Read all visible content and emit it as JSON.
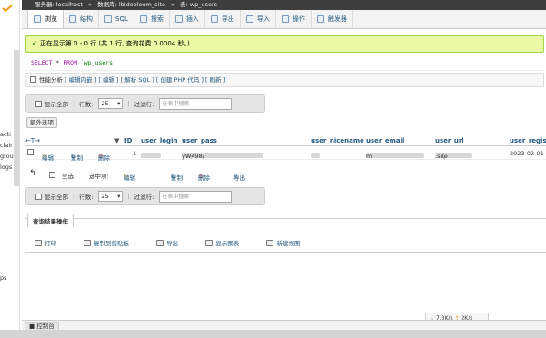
{
  "breadcrumb": {
    "server": "服务器: localhost",
    "database": "数据库: lbidobloom_site",
    "table": "表: wp_users"
  },
  "tabs": [
    {
      "label": "浏览",
      "icon": "browse-icon"
    },
    {
      "label": "结构",
      "icon": "structure-icon"
    },
    {
      "label": "SQL",
      "icon": "sql-icon"
    },
    {
      "label": "搜索",
      "icon": "search-icon"
    },
    {
      "label": "插入",
      "icon": "insert-icon"
    },
    {
      "label": "导出",
      "icon": "export-icon"
    },
    {
      "label": "导入",
      "icon": "import-icon"
    },
    {
      "label": "操作",
      "icon": "wrench-icon"
    },
    {
      "label": "触发器",
      "icon": "triggers-icon"
    }
  ],
  "message": "正在显示第 0 - 0 行 (共 1 行, 查询花费 0.0004 秒。)",
  "sql": {
    "keyword_select": "SELECT",
    "star": "*",
    "keyword_from": "FROM",
    "table": "`wp_users`"
  },
  "profiling": {
    "label": "性能分析",
    "links": "[ 编辑内嵌 ] [ 编辑 ] [ 解析 SQL ] [ 创建 PHP 代码 ] [ 刷新 ]"
  },
  "nav": {
    "show_all": "显示全部",
    "rows_label": "行数:",
    "rows_value": "25",
    "filter_label": "过滤行:",
    "filter_placeholder": "在表中搜索"
  },
  "options_button": "额外选项",
  "table": {
    "arrows": "←T→",
    "headers": [
      "ID",
      "user_login",
      "user_pass",
      "user_nicename",
      "user_email",
      "user_url",
      "user_registe"
    ],
    "row": {
      "edit": "编辑",
      "copy": "复制",
      "delete": "删除",
      "id": "1",
      "login": "k",
      "pass_start": "$P$Bz2",
      "pass_end": "yW498/",
      "email_start": "1",
      "email_end": "m",
      "url_start": "https",
      "url_end": ".site",
      "registered": "2023-02-01"
    }
  },
  "bulk": {
    "check_all": "全选",
    "with_selected": "选中项:",
    "edit": "编辑",
    "copy": "复制",
    "delete": "删除",
    "export": "导出"
  },
  "qro": {
    "title": "查询结果操作",
    "print": "打印",
    "copy_clipboard": "复制到剪贴板",
    "export": "导出",
    "chart": "显示图表",
    "create_view": "新建视图"
  },
  "left": {
    "items": [
      "acti",
      "clair",
      "grou",
      "logs",
      "ps"
    ]
  },
  "footer": {
    "console": "控制台"
  },
  "netspeed": {
    "down": "7.3K/s",
    "up": "2K/s"
  }
}
